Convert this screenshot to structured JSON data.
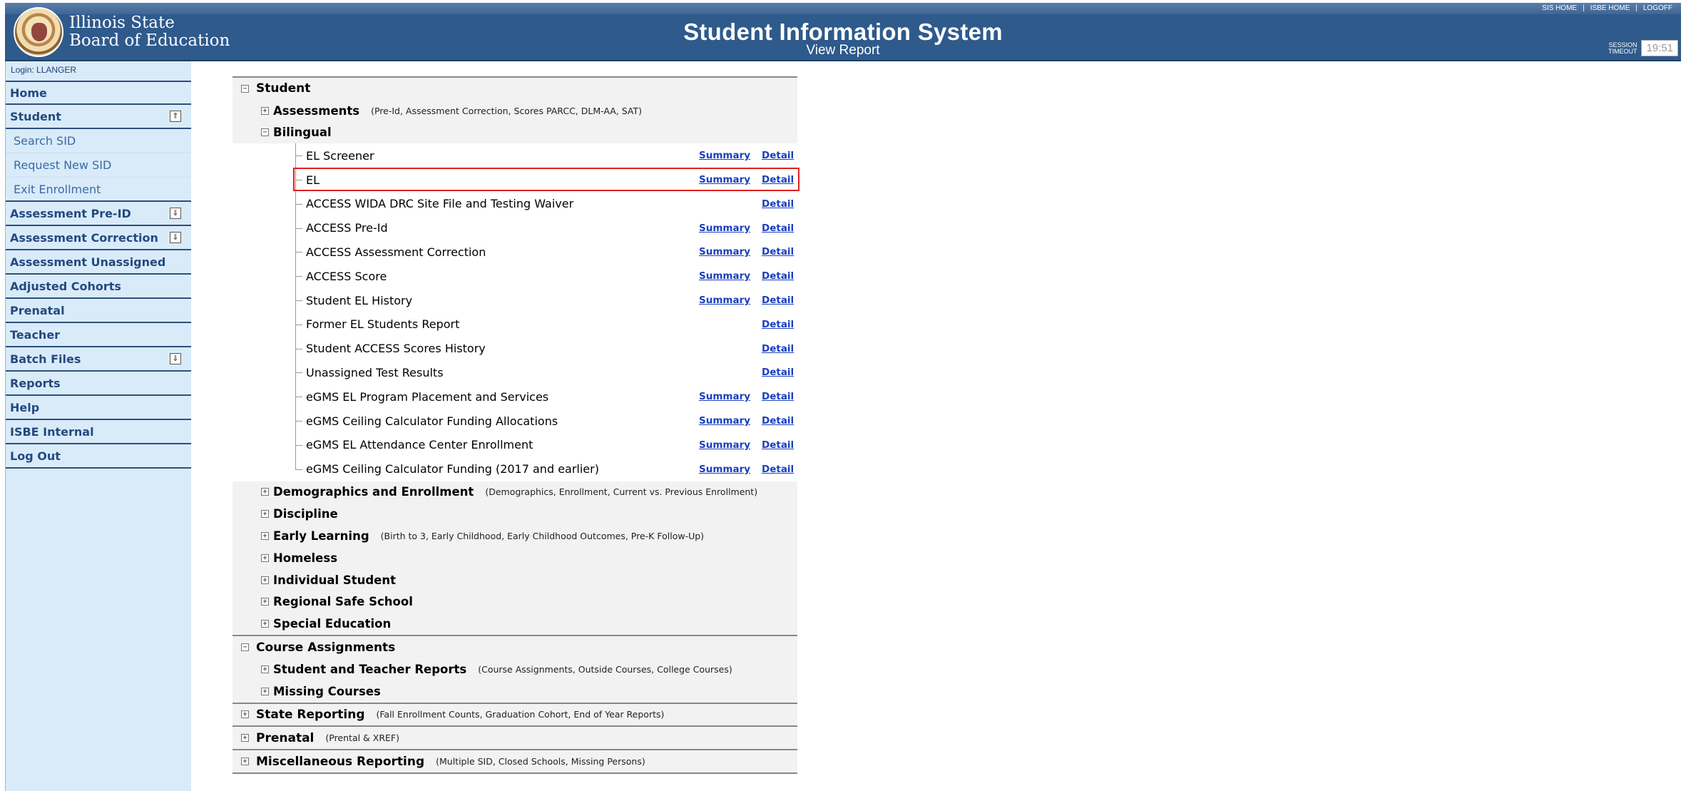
{
  "header": {
    "org_name_line1": "Illinois State",
    "org_name_line2": "Board of Education",
    "title": "Student Information System",
    "subtitle": "View Report",
    "links": [
      "SIS HOME",
      "ISBE HOME",
      "LOGOFF"
    ],
    "session_label_line1": "SESSION",
    "session_label_line2": "TIMEOUT",
    "session_time": "19:51"
  },
  "sidebar": {
    "login": "Login: LLANGER",
    "items": [
      {
        "label": "Home"
      },
      {
        "label": "Student",
        "toggle": "⇑"
      },
      {
        "label": "Search SID",
        "sub": true
      },
      {
        "label": "Request New SID",
        "sub": true
      },
      {
        "label": "Exit Enrollment",
        "sub": true
      },
      {
        "label": "Assessment Pre-ID",
        "toggle": "⇓"
      },
      {
        "label": "Assessment Correction",
        "toggle": "⇓"
      },
      {
        "label": "Assessment Unassigned"
      },
      {
        "label": "Adjusted Cohorts"
      },
      {
        "label": "Prenatal"
      },
      {
        "label": "Teacher"
      },
      {
        "label": "Batch Files",
        "toggle": "⇓"
      },
      {
        "label": "Reports"
      },
      {
        "label": "Help"
      },
      {
        "label": "ISBE Internal"
      },
      {
        "label": "Log Out"
      }
    ]
  },
  "report": {
    "student": {
      "title": "Student",
      "assessments": {
        "title": "Assessments",
        "desc": "(Pre-Id, Assessment Correction, Scores PARCC, DLM-AA, SAT)"
      },
      "bilingual": {
        "title": "Bilingual",
        "leaves": [
          {
            "name": "EL Screener",
            "summary": "Summary",
            "detail": "Detail"
          },
          {
            "name": "EL",
            "summary": "Summary",
            "detail": "Detail"
          },
          {
            "name": "ACCESS WIDA DRC Site File and Testing Waiver",
            "summary": "",
            "detail": "Detail"
          },
          {
            "name": "ACCESS Pre-Id",
            "summary": "Summary",
            "detail": "Detail"
          },
          {
            "name": "ACCESS Assessment Correction",
            "summary": "Summary",
            "detail": "Detail"
          },
          {
            "name": "ACCESS Score",
            "summary": "Summary",
            "detail": "Detail"
          },
          {
            "name": "Student EL History",
            "summary": "Summary",
            "detail": "Detail"
          },
          {
            "name": "Former EL Students Report",
            "summary": "",
            "detail": "Detail"
          },
          {
            "name": "Student ACCESS Scores History",
            "summary": "",
            "detail": "Detail"
          },
          {
            "name": "Unassigned Test Results",
            "summary": "",
            "detail": "Detail"
          },
          {
            "name": "eGMS EL Program Placement and Services",
            "summary": "Summary",
            "detail": "Detail"
          },
          {
            "name": "eGMS Ceiling Calculator Funding Allocations",
            "summary": "Summary",
            "detail": "Detail"
          },
          {
            "name": "eGMS EL Attendance Center Enrollment",
            "summary": "Summary",
            "detail": "Detail"
          },
          {
            "name": "eGMS Ceiling Calculator Funding (2017 and earlier)",
            "summary": "Summary",
            "detail": "Detail"
          }
        ]
      },
      "demographics": {
        "title": "Demographics and Enrollment",
        "desc": "(Demographics, Enrollment, Current vs. Previous Enrollment)"
      },
      "discipline": {
        "title": "Discipline"
      },
      "early_learning": {
        "title": "Early Learning",
        "desc": "(Birth to 3, Early Childhood, Early Childhood Outcomes, Pre-K Follow-Up)"
      },
      "homeless": {
        "title": "Homeless"
      },
      "individual": {
        "title": "Individual Student"
      },
      "regional": {
        "title": "Regional Safe School"
      },
      "special_ed": {
        "title": "Special Education"
      }
    },
    "course": {
      "title": "Course Assignments",
      "student_teacher": {
        "title": "Student and Teacher Reports",
        "desc": "(Course Assignments, Outside Courses, College Courses)"
      },
      "missing": {
        "title": "Missing Courses"
      }
    },
    "state": {
      "title": "State Reporting",
      "desc": "(Fall Enrollment Counts, Graduation Cohort, End of Year Reports)"
    },
    "prenatal": {
      "title": "Prenatal",
      "desc": "(Prental & XREF)"
    },
    "misc": {
      "title": "Miscellaneous Reporting",
      "desc": "(Multiple SID, Closed Schools, Missing Persons)"
    },
    "expand_symbol": "+",
    "collapse_symbol": "−"
  },
  "colors": {
    "header_bg": "#2e5a8c",
    "sidebar_bg": "#d9ebf9",
    "link": "#1a3fbf",
    "highlight": "#e02020"
  }
}
